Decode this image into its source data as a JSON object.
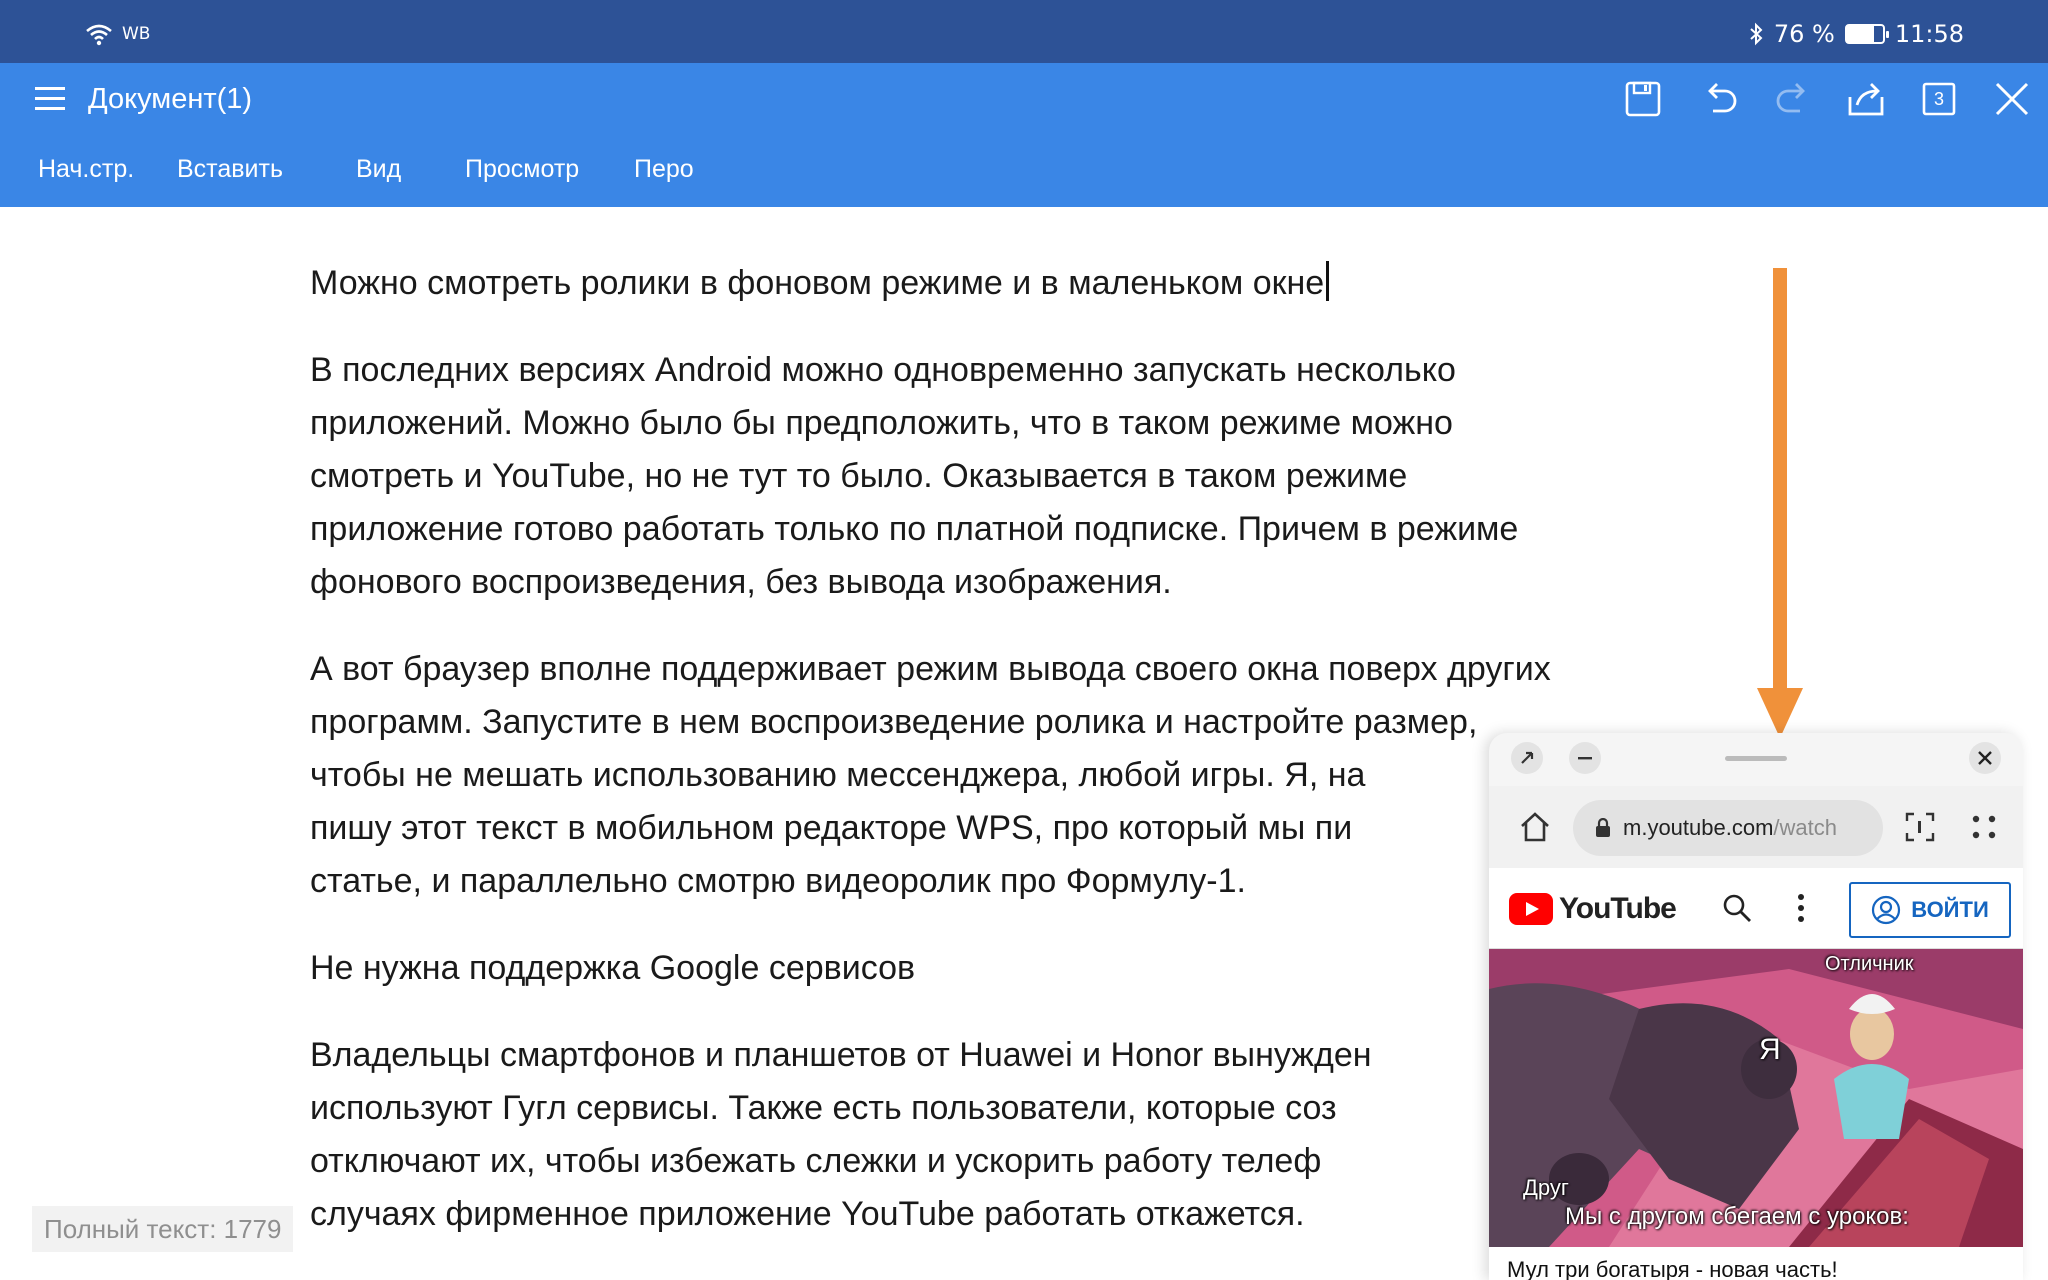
{
  "status_bar": {
    "carrier": "WB",
    "battery_percent": "76 %",
    "battery_level": 0.76,
    "time": "11:58"
  },
  "app_bar": {
    "title": "Документ(1)",
    "icons": [
      "menu-icon",
      "save-icon",
      "undo-icon",
      "redo-icon",
      "share-icon",
      "pages-icon",
      "close-icon"
    ],
    "pages_count": "3",
    "tabs": [
      "Нач.стр.",
      "Вставить",
      "Вид",
      "Просмотр",
      "Перо"
    ]
  },
  "document": {
    "heading1": "Можно смотреть ролики в фоновом режиме и в маленьком окне",
    "para1": [
      "В последних версиях Android можно одновременно запускать несколько",
      "приложений. Можно было бы предположить, что в таком режиме можно",
      "смотреть и YouTube, но не тут то было. Оказывается в таком режиме",
      "приложение готово работать только по платной подписке. Причем в режиме",
      "фонового воспроизведения, без вывода изображения."
    ],
    "para2": [
      "А вот браузер вполне поддерживает режим вывода своего окна поверх других",
      "программ. Запустите в нем воспроизведение ролика и настройте размер,",
      "чтобы не мешать использованию мессенджера, любой игры. Я, на",
      "пишу этот текст в мобильном редакторе WPS, про который мы пи",
      "статье, и параллельно смотрю видеоролик про Формулу-1."
    ],
    "heading2": "Не нужна поддержка Google сервисов",
    "para3": [
      "Владельцы смартфонов и планшетов от Huawei и Honor вынужден",
      "используют Гугл сервисы. Также есть пользователи, которые соз",
      "отключают их, чтобы избежать слежки и ускорить работу телеф",
      "случаях фирменное приложение YouTube работать откажется."
    ]
  },
  "word_count": "Полный текст: 1779",
  "floating_window": {
    "url_host": "m.youtube.com",
    "url_path": "/watch",
    "yt_logo_text": "YouTube",
    "login_label": "ВОЙТИ",
    "video": {
      "label_top": "Отличник",
      "label_me": "Я",
      "label_friend": "Друг",
      "subtitle": "Мы с другом сбегаем с уроков:"
    },
    "below_title": "Мул три богатыря - новая часть!"
  },
  "colors": {
    "status_bar": "#2d5296",
    "app_bar": "#3a86e6",
    "annotation_arrow": "#f0913a",
    "youtube_red": "#ff0000"
  }
}
